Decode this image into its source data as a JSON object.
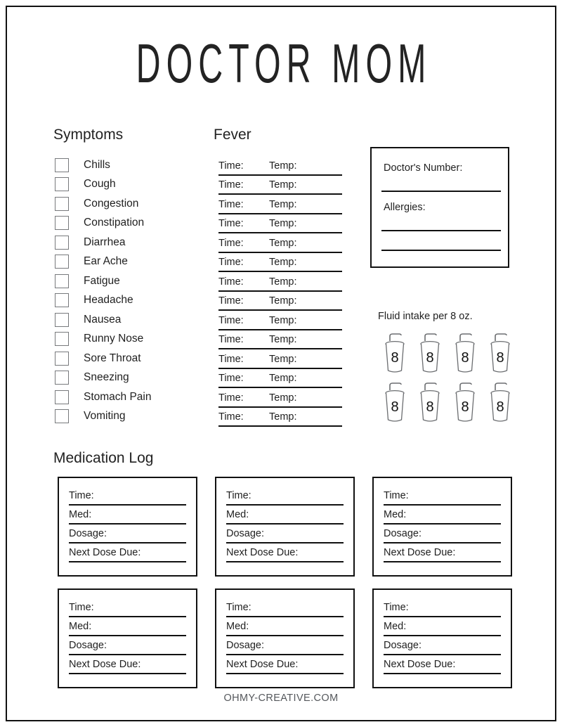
{
  "document": {
    "title": "DOCTOR MOM",
    "footer": "OHMY-CREATIVE.COM"
  },
  "symptoms": {
    "heading": "Symptoms",
    "items": [
      "Chills",
      "Cough",
      "Congestion",
      "Constipation",
      "Diarrhea",
      "Ear Ache",
      "Fatigue",
      "Headache",
      "Nausea",
      "Runny Nose",
      "Sore Throat",
      "Sneezing",
      "Stomach Pain",
      "Vomiting"
    ]
  },
  "fever": {
    "heading": "Fever",
    "time_label": "Time:",
    "temp_label": "Temp:",
    "row_count": 14
  },
  "doctor_info": {
    "number_label": "Doctor's Number:",
    "allergies_label": "Allergies:"
  },
  "fluid_intake": {
    "heading": "Fluid intake per 8 oz.",
    "cup_value": "8",
    "cup_count": 8
  },
  "medication_log": {
    "heading": "Medication Log",
    "card_count": 6,
    "fields": [
      "Time:",
      "Med:",
      "Dosage:",
      "Next Dose Due:"
    ]
  },
  "colors": {
    "ink": "#111111",
    "text": "#1f1f1f",
    "checkbox_border": "#77797c",
    "footer_text": "#55585c",
    "paper": "#ffffff"
  }
}
